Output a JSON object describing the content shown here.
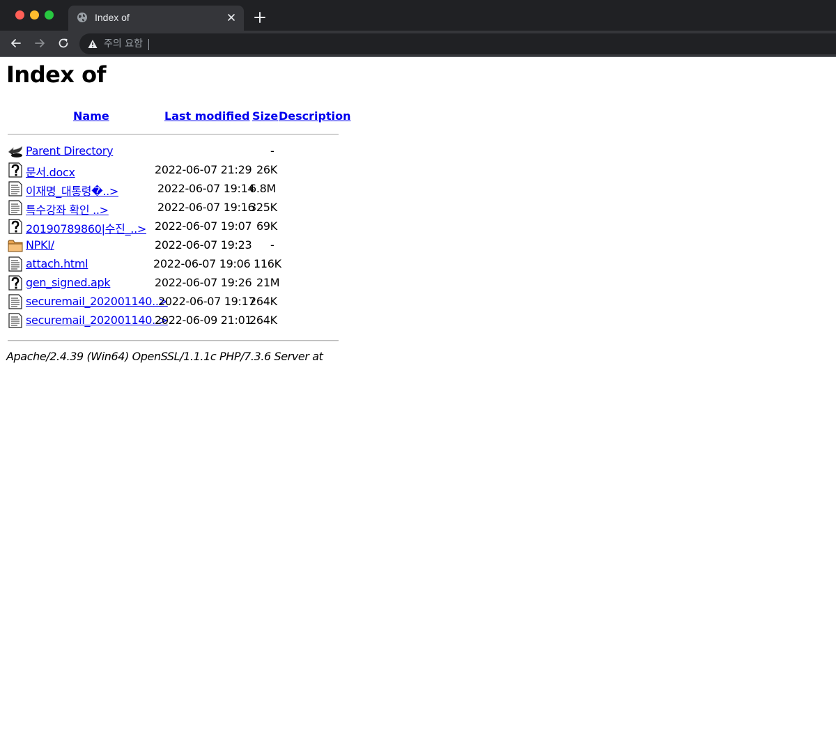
{
  "browser": {
    "tab_title": "Index of",
    "omnibox_status": "주의 요함",
    "omnibox_url": ""
  },
  "page": {
    "title": "Index of",
    "columns": {
      "name": "Name",
      "last_modified": "Last modified",
      "size": "Size",
      "description": "Description"
    },
    "rows": [
      {
        "icon": "back-icon",
        "name": "Parent Directory",
        "date": "",
        "size": "-"
      },
      {
        "icon": "unknown-file-icon",
        "name": "문서.docx",
        "date": "2022-06-07 21:29",
        "size": "26K"
      },
      {
        "icon": "text-file-icon",
        "name": "이재명_대통령�..>",
        "date": "2022-06-07 19:14",
        "size": "6.8M"
      },
      {
        "icon": "text-file-icon",
        "name": "특수강좌 확인 ..>",
        "date": "2022-06-07 19:16",
        "size": "325K"
      },
      {
        "icon": "unknown-file-icon",
        "name": "20190789860|수진_..>",
        "date": "2022-06-07 19:07",
        "size": "69K"
      },
      {
        "icon": "folder-icon",
        "name": "NPKI/",
        "date": "2022-06-07 19:23",
        "size": "-"
      },
      {
        "icon": "text-file-icon",
        "name": "attach.html",
        "date": "2022-06-07 19:06",
        "size": "116K"
      },
      {
        "icon": "unknown-file-icon",
        "name": "gen_signed.apk",
        "date": "2022-06-07 19:26",
        "size": "21M"
      },
      {
        "icon": "text-file-icon",
        "name": "securemail_202001140..>",
        "date": "2022-06-07 19:17",
        "size": "264K"
      },
      {
        "icon": "text-file-icon",
        "name": "securemail_202001140..>",
        "date": "2022-06-09 21:01",
        "size": "264K"
      }
    ],
    "server_signature": "Apache/2.4.39 (Win64) OpenSSL/1.1.1c PHP/7.3.6 Server at"
  }
}
